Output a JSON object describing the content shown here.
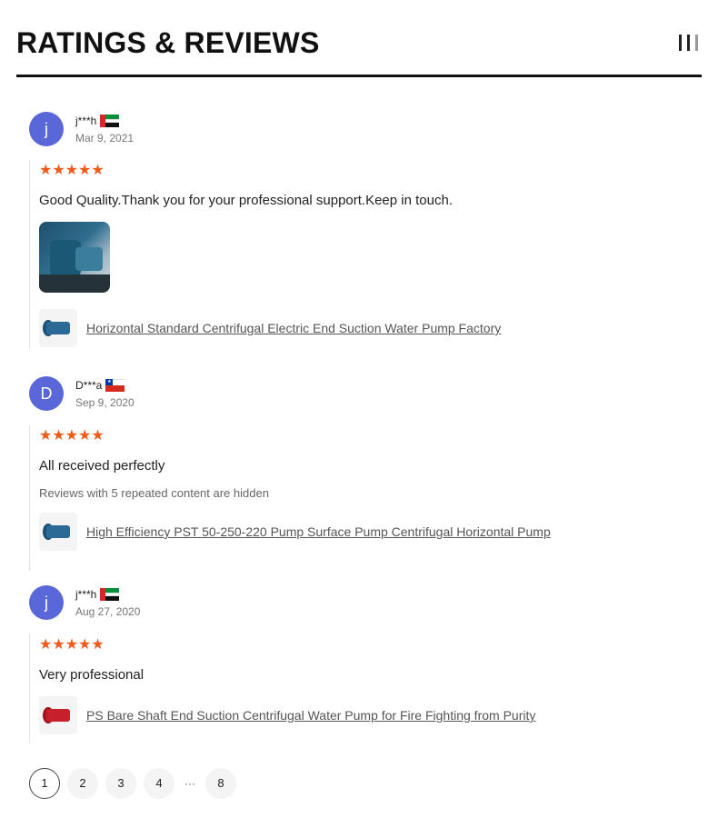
{
  "header": {
    "title": "RATINGS & REVIEWS",
    "icon": "bars-icon"
  },
  "reviews": [
    {
      "initial": "j",
      "user": "j***h",
      "flag": "uae-flag-icon",
      "date": "Mar 9, 2021",
      "stars": "★★★★★",
      "rating": 5,
      "text": "Good Quality.Thank you for your professional support.Keep in touch.",
      "product": "Horizontal Standard Centrifugal Electric End Suction Water Pump Factory"
    },
    {
      "initial": "D",
      "user": "D***a",
      "flag": "chile-flag-icon",
      "date": "Sep 9, 2020",
      "stars": "★★★★★",
      "rating": 5,
      "text": "All received perfectly",
      "note": "Reviews with 5 repeated content are hidden",
      "product": "High Efficiency PST 50-250-220 Pump Surface Pump Centrifugal Horizontal Pump"
    },
    {
      "initial": "j",
      "user": "j***h",
      "flag": "uae-flag-icon",
      "date": "Aug 27, 2020",
      "stars": "★★★★★",
      "rating": 5,
      "text": "Very professional",
      "product": "PS Bare Shaft End Suction Centrifugal Water Pump for Fire Fighting from Purity"
    }
  ],
  "pagination": {
    "pages": [
      "1",
      "2",
      "3",
      "4"
    ],
    "ellipsis": "···",
    "last": "8",
    "current": "1"
  },
  "colors": {
    "star": "#f05a1a",
    "avatar": "#5a67d8"
  }
}
